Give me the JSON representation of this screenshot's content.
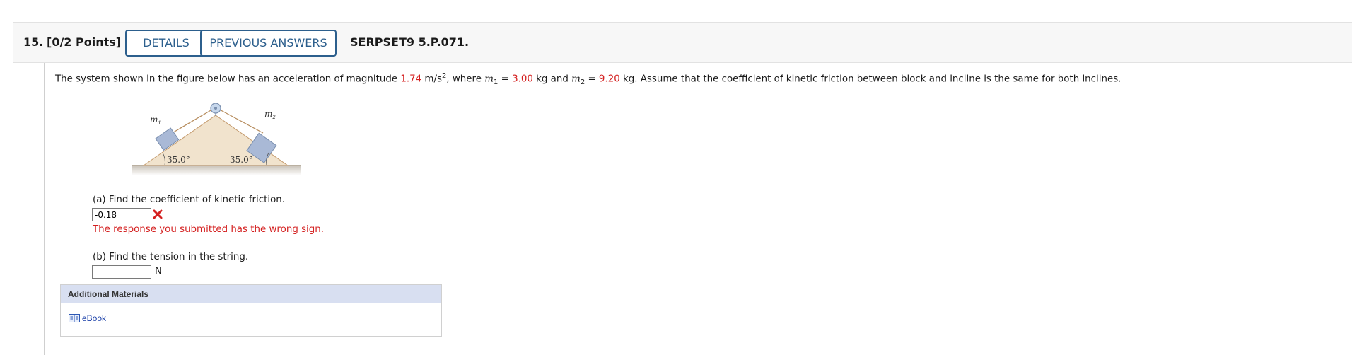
{
  "question": {
    "number": "15.",
    "points": "[0/2 Points]",
    "details_label": "DETAILS",
    "previous_answers_label": "PREVIOUS ANSWERS",
    "code": "SERPSET9 5.P.071."
  },
  "prompt": {
    "part1": "The system shown in the figure below has an acceleration of magnitude ",
    "accel_value": "1.74",
    "accel_unit": " m/s",
    "accel_exp": "2",
    "part2": ", where ",
    "m1_symbol": "m",
    "m1_sub": "1",
    "eq1": " = ",
    "m1_value": "3.00",
    "m1_unit": " kg and ",
    "m2_symbol": "m",
    "m2_sub": "2",
    "eq2": " = ",
    "m2_value": "9.20",
    "part3": " kg. Assume that the coefficient of kinetic friction between block and incline is the same for both inclines."
  },
  "figure": {
    "m1_label": "m",
    "m1_sub": "1",
    "m2_label": "m",
    "m2_sub": "2",
    "angle_left": "35.0°",
    "angle_right": "35.0°"
  },
  "part_a": {
    "question": "(a) Find the coefficient of kinetic friction.",
    "answer_value": "-0.18",
    "status": "incorrect",
    "feedback": "The response you submitted has the wrong sign."
  },
  "part_b": {
    "question": "(b) Find the tension in the string.",
    "answer_value": "",
    "unit": "N"
  },
  "additional_materials": {
    "heading": "Additional Materials",
    "ebook_label": "eBook"
  },
  "colors": {
    "button_border": "#2c5f8d",
    "error_red": "#d42020",
    "materials_header": "#d8dff1",
    "link_blue": "#1a3fa8"
  }
}
